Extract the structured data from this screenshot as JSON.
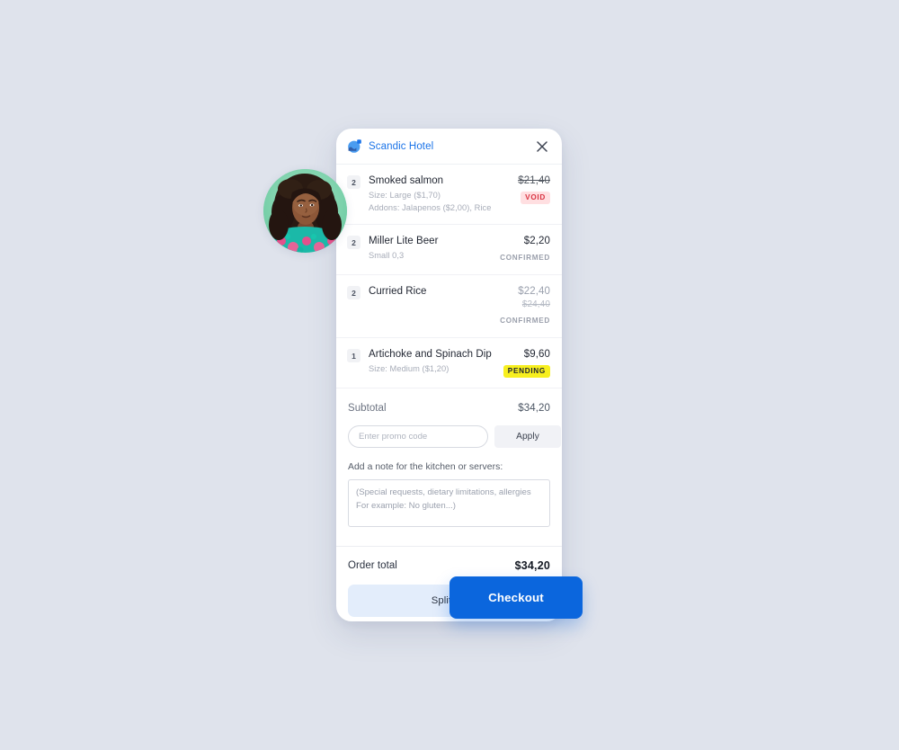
{
  "theme": {
    "page_background": "#dfe3ec",
    "brand_blue": "#1a73e8",
    "checkout_blue": "#0b66dd",
    "split_bill_bg": "#e3edfb",
    "void_badge_bg": "#ffdfe1",
    "void_badge_text": "#d93442",
    "pending_badge_bg": "#f7ef1f",
    "pending_badge_text": "#1f2430",
    "card_background": "#ffffff"
  },
  "header": {
    "logo_icon": "scandic-logo-icon",
    "brand_name": "Scandic Hotel",
    "close_icon": "close-icon"
  },
  "avatar": {
    "icon": "user-avatar-photo"
  },
  "items": [
    {
      "qty": "2",
      "name": "Smoked salmon",
      "meta": [
        "Size: Large ($1,70)",
        "Addons: Jalapenos ($2,00), Rice"
      ],
      "price": "$21,40",
      "price_struck": true,
      "price_muted": false,
      "sub_price": "",
      "status_type": "badge",
      "status": "VOID",
      "status_style": "void"
    },
    {
      "qty": "2",
      "name": "Miller Lite Beer",
      "meta": [
        "Small 0,3"
      ],
      "price": "$2,20",
      "price_struck": false,
      "price_muted": false,
      "sub_price": "",
      "status_type": "text",
      "status": "CONFIRMED",
      "status_style": "confirmed"
    },
    {
      "qty": "2",
      "name": "Curried Rice",
      "meta": [],
      "price": "$22,40",
      "price_struck": false,
      "price_muted": true,
      "sub_price": "$24,40",
      "status_type": "text",
      "status": "CONFIRMED",
      "status_style": "confirmed"
    },
    {
      "qty": "1",
      "name": "Artichoke and Spinach Dip",
      "meta": [
        "Size: Medium ($1,20)"
      ],
      "price": "$9,60",
      "price_struck": false,
      "price_muted": false,
      "sub_price": "",
      "status_type": "badge",
      "status": "PENDING",
      "status_style": "pending"
    }
  ],
  "subtotal": {
    "label": "Subtotal",
    "value": "$34,20"
  },
  "promo": {
    "placeholder": "Enter promo code",
    "value": "",
    "apply_label": "Apply"
  },
  "note": {
    "label": "Add a note for the kitchen or servers:",
    "placeholder": "(Special requests, dietary limitations, allergies For example: No gluten...)",
    "value": ""
  },
  "order_total": {
    "label": "Order total",
    "value": "$34,20"
  },
  "actions": {
    "split_bill_label": "Split bill",
    "checkout_label": "Checkout"
  }
}
